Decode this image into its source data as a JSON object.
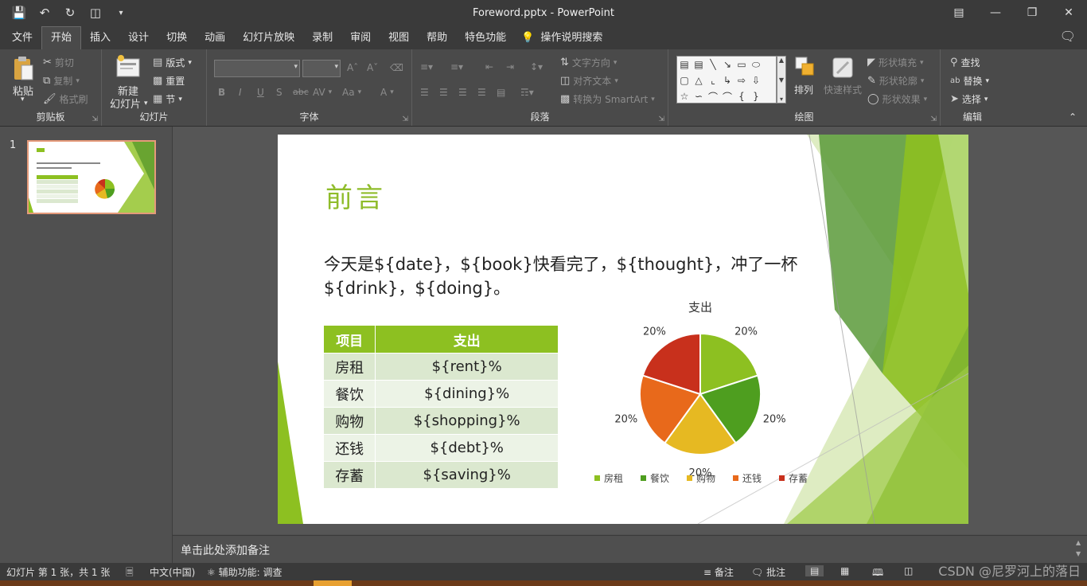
{
  "window": {
    "title": "Foreword.pptx  -  PowerPoint"
  },
  "tabs": [
    "文件",
    "开始",
    "插入",
    "设计",
    "切换",
    "动画",
    "幻灯片放映",
    "录制",
    "审阅",
    "视图",
    "帮助",
    "特色功能"
  ],
  "active_tab": "开始",
  "tell_me": "操作说明搜索",
  "ribbon": {
    "clipboard": {
      "paste": "粘贴",
      "cut": "剪切",
      "copy": "复制",
      "format_painter": "格式刷",
      "label": "剪贴板"
    },
    "slides": {
      "new_slide": "新建幻灯片",
      "new_slide_line1": "新建",
      "new_slide_line2": "幻灯片",
      "layout": "版式",
      "reset": "重置",
      "section": "节",
      "label": "幻灯片"
    },
    "font": {
      "label": "字体",
      "bold": "B",
      "italic": "I",
      "underline": "U",
      "shadow": "S",
      "strike": "abc",
      "spacing": "AV",
      "case": "Aa",
      "color": "A"
    },
    "paragraph": {
      "label": "段落",
      "text_direction": "文字方向",
      "align_text": "对齐文本",
      "smartart": "转换为 SmartArt"
    },
    "drawing": {
      "label": "绘图",
      "arrange": "排列",
      "quick_styles": "快速样式",
      "shape_fill": "形状填充",
      "shape_outline": "形状轮廓",
      "shape_effects": "形状效果"
    },
    "editing": {
      "label": "编辑",
      "find": "查找",
      "replace": "替换",
      "select": "选择"
    }
  },
  "thumbnail": {
    "number": "1"
  },
  "slide": {
    "title": "前言",
    "body": "今天是${date}，${book}快看完了，${thought}，冲了一杯${drink}，${doing}。",
    "table": {
      "headers": [
        "项目",
        "支出"
      ],
      "rows": [
        [
          "房租",
          "${rent}%"
        ],
        [
          "餐饮",
          "${dining}%"
        ],
        [
          "购物",
          "${shopping}%"
        ],
        [
          "还钱",
          "${debt}%"
        ],
        [
          "存蓄",
          "${saving}%"
        ]
      ]
    }
  },
  "chart_data": {
    "type": "pie",
    "title": "支出",
    "categories": [
      "房租",
      "餐饮",
      "购物",
      "还钱",
      "存蓄"
    ],
    "values": [
      20,
      20,
      20,
      20,
      20
    ],
    "data_labels": [
      "20%",
      "20%",
      "20%",
      "20%",
      "20%"
    ],
    "colors": [
      "#8dc021",
      "#4e9e1f",
      "#e6b922",
      "#e8691b",
      "#c8301c"
    ],
    "legend": "bottom"
  },
  "notes_placeholder": "单击此处添加备注",
  "status": {
    "slide_info": "幻灯片 第 1 张，共 1 张",
    "language": "中文(中国)",
    "accessibility": "辅助功能: 调查",
    "notes": "备注",
    "comments": "批注"
  },
  "watermark": "CSDN @尼罗河上的落日"
}
